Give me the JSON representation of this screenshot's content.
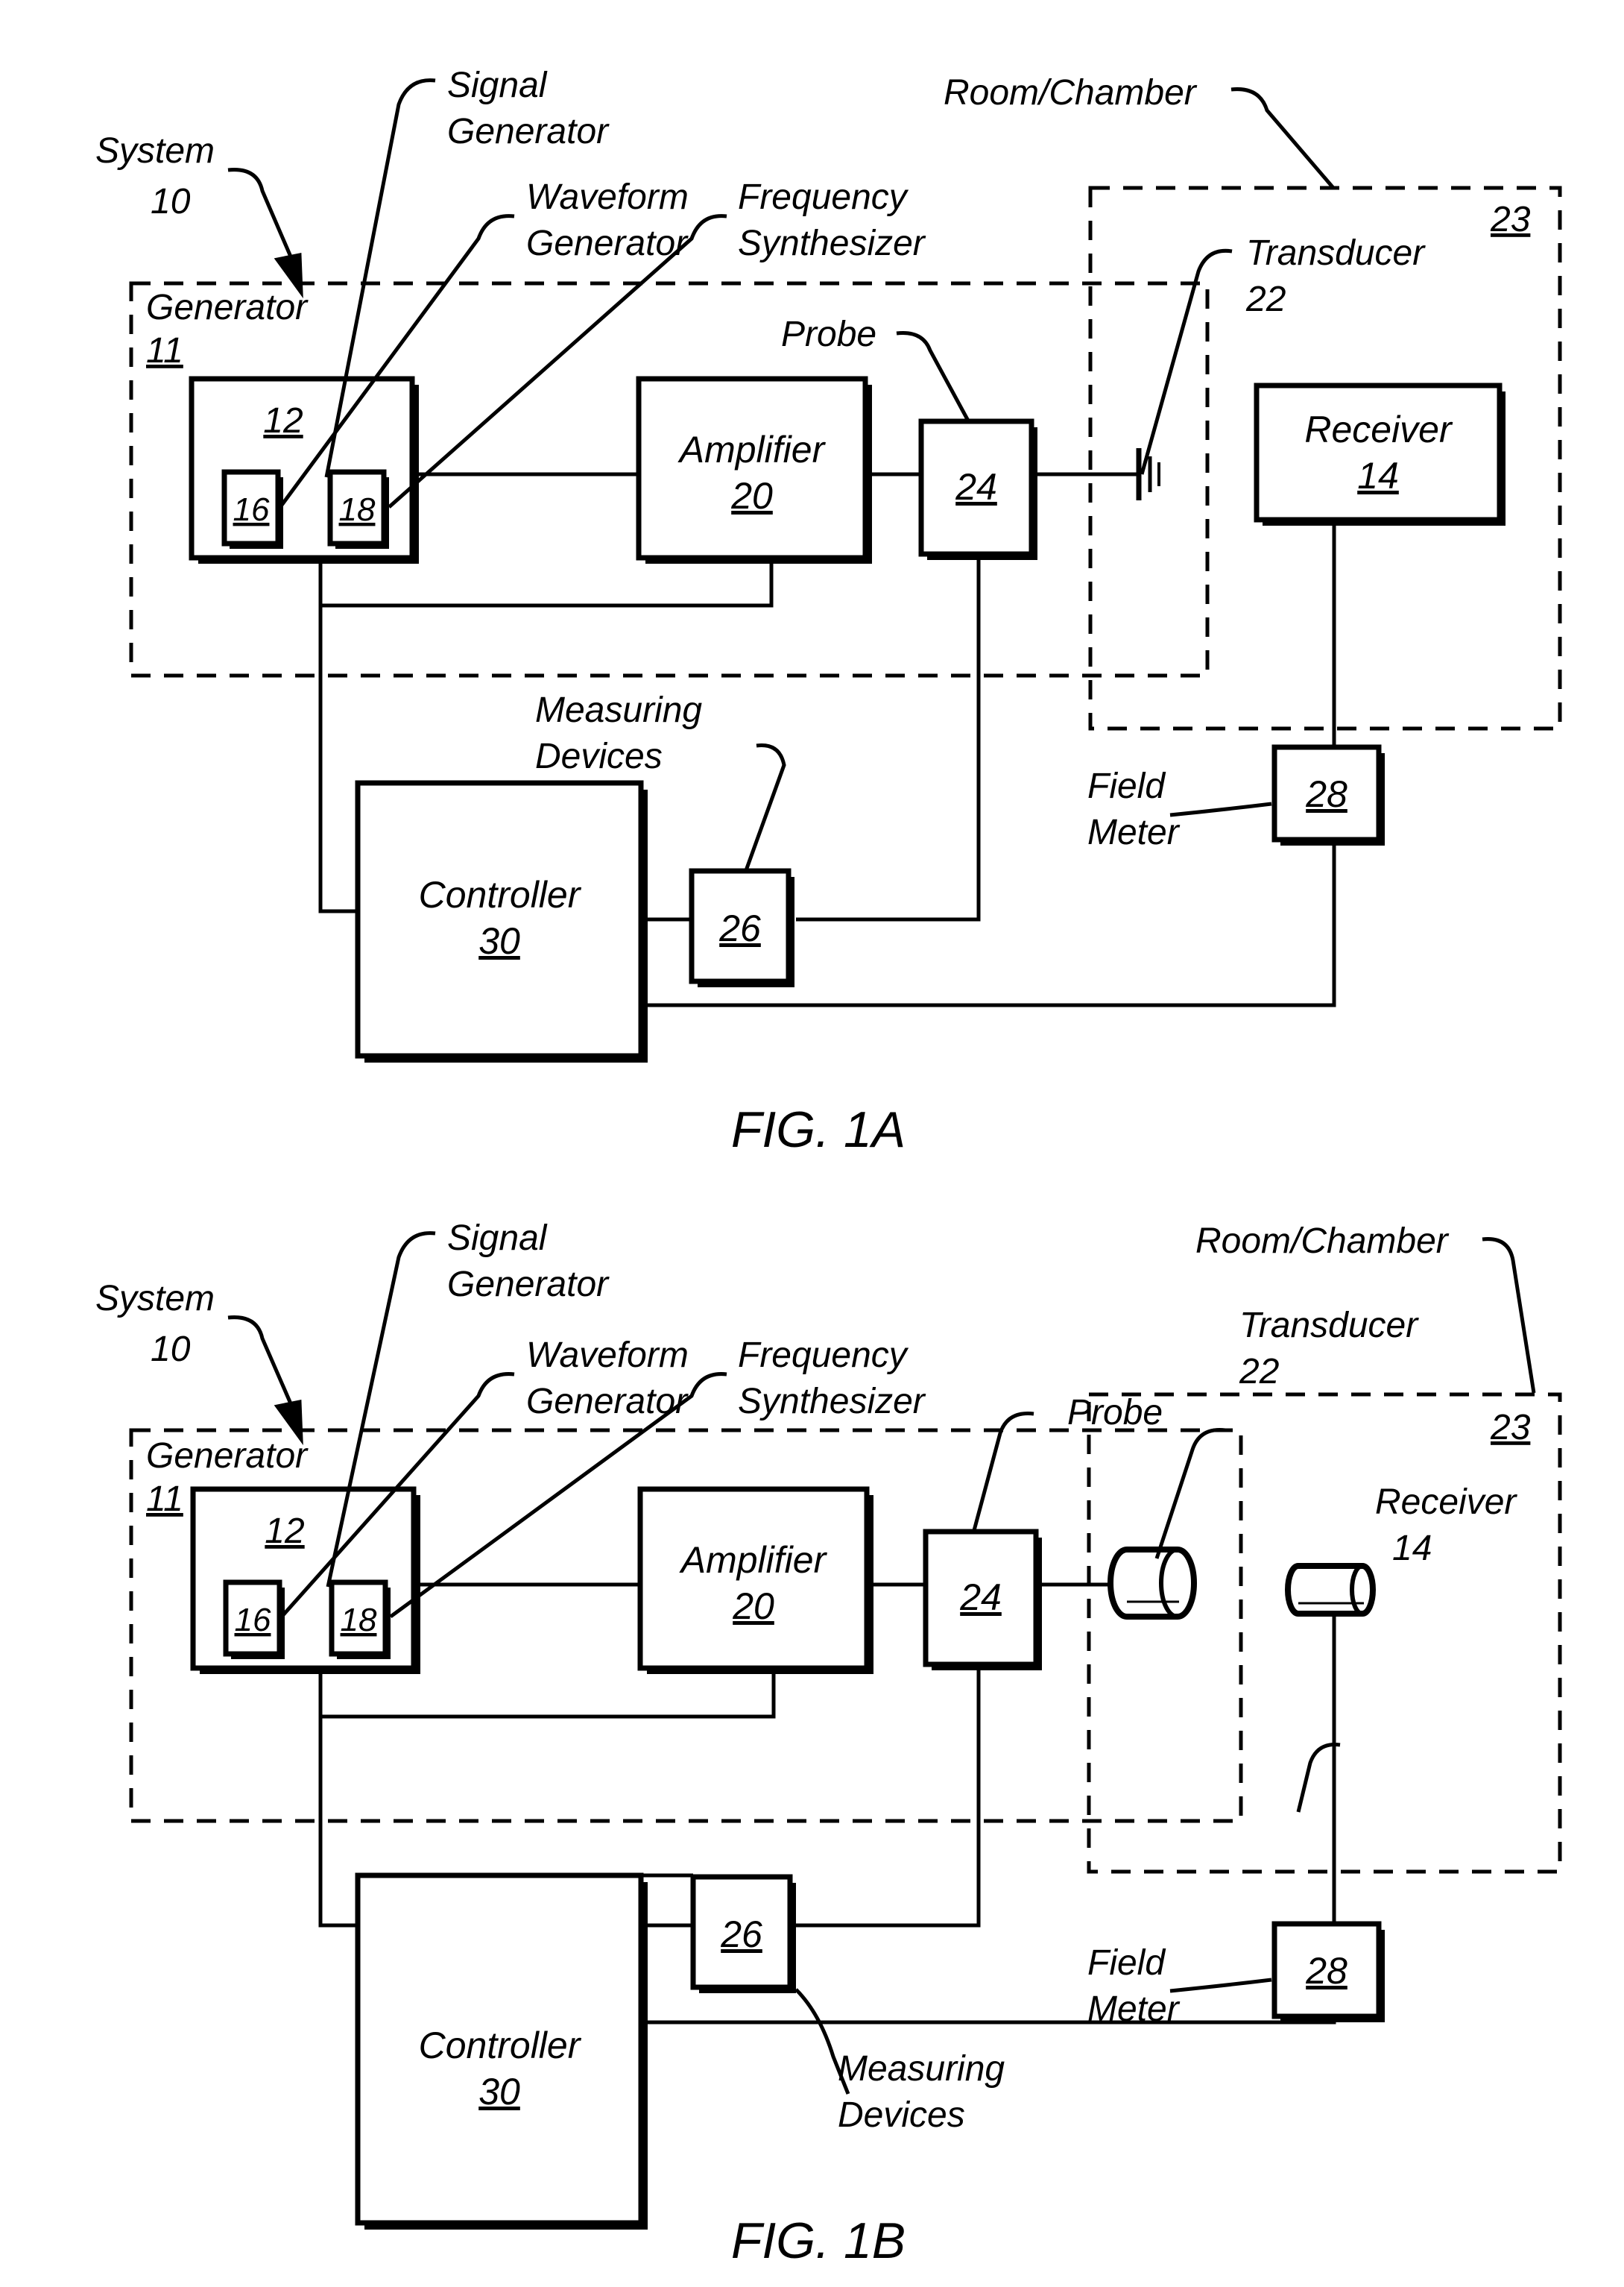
{
  "document": {
    "type": "patent-drawing-sheet",
    "figures": [
      {
        "id": "fig-1a",
        "caption": "FIG. 1A",
        "callout_labels": {
          "system": "System",
          "system_num": "10",
          "signal_generator": "Signal\nGenerator",
          "signal_generator_l1": "Signal",
          "signal_generator_l2": "Generator",
          "waveform_generator_l1": "Waveform",
          "waveform_generator_l2": "Generator",
          "frequency_synthesizer_l1": "Frequency",
          "frequency_synthesizer_l2": "Synthesizer",
          "room_chamber": "Room/Chamber",
          "transducer": "Transducer",
          "transducer_num": "22",
          "probe": "Probe",
          "measuring_devices_l1": "Measuring",
          "measuring_devices_l2": "Devices",
          "field_meter_l1": "Field",
          "field_meter_l2": "Meter"
        },
        "blocks": [
          {
            "name": "generator-dashed-box",
            "label": "Generator",
            "ref": "11"
          },
          {
            "name": "room-chamber-dashed-box",
            "label": "",
            "ref": "23"
          },
          {
            "name": "signal-generator-box",
            "label": "",
            "ref": "12"
          },
          {
            "name": "waveform-generator-box",
            "label": "",
            "ref": "16"
          },
          {
            "name": "frequency-synthesizer-box",
            "label": "",
            "ref": "18"
          },
          {
            "name": "amplifier-box",
            "label": "Amplifier",
            "ref": "20"
          },
          {
            "name": "probe-box",
            "label": "",
            "ref": "24"
          },
          {
            "name": "receiver-box",
            "label": "Receiver",
            "ref": "14"
          },
          {
            "name": "measuring-devices-box",
            "label": "",
            "ref": "26"
          },
          {
            "name": "field-meter-box",
            "label": "",
            "ref": "28"
          },
          {
            "name": "controller-box",
            "label": "Controller",
            "ref": "30"
          }
        ]
      },
      {
        "id": "fig-1b",
        "caption": "FIG. 1B",
        "callout_labels": {
          "system": "System",
          "system_num": "10",
          "signal_generator_l1": "Signal",
          "signal_generator_l2": "Generator",
          "waveform_generator_l1": "Waveform",
          "waveform_generator_l2": "Generator",
          "frequency_synthesizer_l1": "Frequency",
          "frequency_synthesizer_l2": "Synthesizer",
          "room_chamber": "Room/Chamber",
          "transducer": "Transducer",
          "transducer_num": "22",
          "probe": "Probe",
          "receiver": "Receiver",
          "receiver_num": "14",
          "measuring_devices_l1": "Measuring",
          "measuring_devices_l2": "Devices",
          "field_meter_l1": "Field",
          "field_meter_l2": "Meter"
        },
        "blocks": [
          {
            "name": "generator-dashed-box",
            "label": "Generator",
            "ref": "11"
          },
          {
            "name": "room-chamber-dashed-box",
            "label": "",
            "ref": "23"
          },
          {
            "name": "signal-generator-box",
            "label": "",
            "ref": "12"
          },
          {
            "name": "waveform-generator-box",
            "label": "",
            "ref": "16"
          },
          {
            "name": "frequency-synthesizer-box",
            "label": "",
            "ref": "18"
          },
          {
            "name": "amplifier-box",
            "label": "Amplifier",
            "ref": "20"
          },
          {
            "name": "probe-box",
            "label": "",
            "ref": "24"
          },
          {
            "name": "transducer-cylinder",
            "label": "",
            "ref": "22"
          },
          {
            "name": "receiver-cylinder",
            "label": "",
            "ref": "14"
          },
          {
            "name": "measuring-devices-box",
            "label": "",
            "ref": "26"
          },
          {
            "name": "field-meter-box",
            "label": "",
            "ref": "28"
          },
          {
            "name": "controller-box",
            "label": "Controller",
            "ref": "30"
          }
        ]
      }
    ]
  },
  "figA": {
    "caption": "FIG. 1A",
    "system": "System",
    "system_num": "10",
    "sig_gen_1": "Signal",
    "sig_gen_2": "Generator",
    "wave_gen_1": "Waveform",
    "wave_gen_2": "Generator",
    "freq_syn_1": "Frequency",
    "freq_syn_2": "Synthesizer",
    "room_chamber": "Room/Chamber",
    "transducer": "Transducer",
    "transducer_num": "22",
    "probe": "Probe",
    "meas_1": "Measuring",
    "meas_2": "Devices",
    "field_1": "Field",
    "field_2": "Meter",
    "generator": "Generator",
    "generator_ref": "11",
    "chamber_ref": "23",
    "ref12": "12",
    "ref16": "16",
    "ref18": "18",
    "amplifier": "Amplifier",
    "ref20": "20",
    "ref24": "24",
    "receiver": "Receiver",
    "ref14": "14",
    "ref26": "26",
    "ref28": "28",
    "controller": "Controller",
    "ref30": "30"
  },
  "figB": {
    "caption": "FIG. 1B",
    "system": "System",
    "system_num": "10",
    "sig_gen_1": "Signal",
    "sig_gen_2": "Generator",
    "wave_gen_1": "Waveform",
    "wave_gen_2": "Generator",
    "freq_syn_1": "Frequency",
    "freq_syn_2": "Synthesizer",
    "room_chamber": "Room/Chamber",
    "transducer": "Transducer",
    "transducer_num": "22",
    "probe": "Probe",
    "receiver_lbl": "Receiver",
    "receiver_num": "14",
    "meas_1": "Measuring",
    "meas_2": "Devices",
    "field_1": "Field",
    "field_2": "Meter",
    "generator": "Generator",
    "generator_ref": "11",
    "chamber_ref": "23",
    "ref12": "12",
    "ref16": "16",
    "ref18": "18",
    "amplifier": "Amplifier",
    "ref20": "20",
    "ref24": "24",
    "ref26": "26",
    "ref28": "28",
    "controller": "Controller",
    "ref30": "30"
  },
  "style": {
    "ink": "#000000",
    "paper": "#ffffff"
  }
}
